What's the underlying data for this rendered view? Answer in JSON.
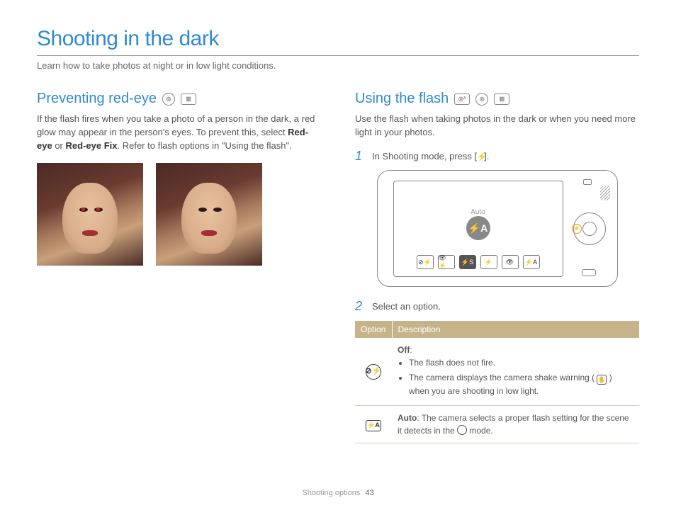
{
  "page": {
    "title": "Shooting in the dark",
    "subtitle": "Learn how to take photos at night or in low light conditions."
  },
  "left": {
    "heading": "Preventing red-eye",
    "mode_icons": [
      "camera-mode-icon",
      "video-mode-icon"
    ],
    "body_pre": "If the flash fires when you take a photo of a person in the dark, a red glow may appear in the person's eyes. To prevent this, select ",
    "bold1": "Red-eye",
    "mid": " or ",
    "bold2": "Red-eye Fix",
    "body_post": ". Refer to flash options in \"Using the flash\"."
  },
  "right": {
    "heading": "Using the flash",
    "mode_icons": [
      "smart-auto-mode-icon",
      "camera-mode-icon",
      "video-mode-icon"
    ],
    "body": "Use the flash when taking photos in the dark or when you need more light in your photos.",
    "step1": {
      "num": "1",
      "text_pre": "In Shooting mode, press [",
      "text_post": "]."
    },
    "camera": {
      "popup_label": "Auto",
      "popup_glyph": "⚡A",
      "options": [
        "⊘⚡",
        "👁⚡",
        "⚡S",
        "⚡",
        "👁",
        "⚡A"
      ],
      "selected_index": 2,
      "highlight_glyph": "⚡"
    },
    "step2": {
      "num": "2",
      "text": "Select an option."
    },
    "table": {
      "head_option": "Option",
      "head_desc": "Description",
      "rows": [
        {
          "icon": "⊘⚡",
          "icon_name": "flash-off-icon",
          "title": "Off",
          "bullets": [
            "The flash does not fire.",
            "The camera displays the camera shake warning ( __SHAKE__ ) when you are shooting in low light."
          ]
        },
        {
          "icon": "⚡A",
          "icon_name": "flash-auto-icon",
          "title": "Auto",
          "desc": ": The camera selects a proper flash setting for the scene it detects in the __DIAL__ mode."
        }
      ]
    }
  },
  "footer": {
    "section": "Shooting options",
    "page_number": "43"
  }
}
